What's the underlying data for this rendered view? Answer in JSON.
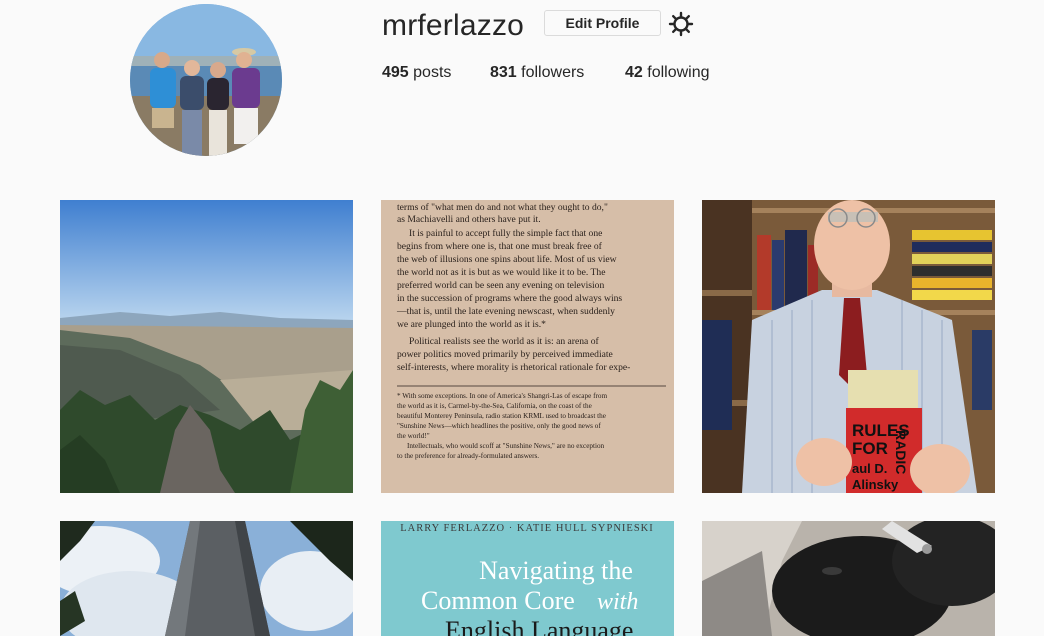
{
  "profile": {
    "username": "mrferlazzo",
    "edit_label": "Edit Profile",
    "stats": {
      "posts_count": "495",
      "posts_label": "posts",
      "followers_count": "831",
      "followers_label": "followers",
      "following_count": "42",
      "following_label": "following"
    }
  },
  "posts": {
    "page_text": [
      "terms of \"what men do and not what they ought to do,\"",
      "as Machiavelli and others have put it.",
      "It is painful to accept fully the simple fact that one",
      "begins from where one is, that one must break free of",
      "the web of illusions one spins about life. Most of us view",
      "the world not as it is but as we would like it to be. The",
      "preferred world can be seen any evening on television",
      "in the succession of programs where the good always wins",
      "—that is, until the late evening newscast, when suddenly",
      "we are plunged into the world as it is.*",
      "Political realists see the world as it is: an arena of",
      "power politics moved primarily by perceived immediate",
      "self-interests, where morality is rhetorical rationale for expe-",
      "* With some exceptions. In one of America's Shangri-Las of escape from",
      "the world as it is, Carmel-by-the-Sea, California, on the coast of the",
      "beautiful Monterey Peninsula, radio station KRML used to broadcast the",
      "\"Sunshine News—which headlines the positive, only the good news of",
      "the world!\"",
      "Intellectuals, who would scoff at \"Sunshine News,\" are no exception",
      "to the preference for already-formulated answers."
    ],
    "book_title_1": "RULES",
    "book_title_2": "FOR",
    "book_title_3": "RADIC",
    "book_author_1": "aul D.",
    "book_author_2": "Alinsky",
    "cover_authors": "LARRY FERLAZZO · KATIE HULL SYPNIESKI",
    "cover_title_1": "Navigating the",
    "cover_title_2": "Common Core",
    "cover_title_with": "with",
    "cover_title_3": "English Language"
  },
  "colors": {
    "background": "#fafafa",
    "text": "#262626",
    "border": "#dbdbdb"
  }
}
